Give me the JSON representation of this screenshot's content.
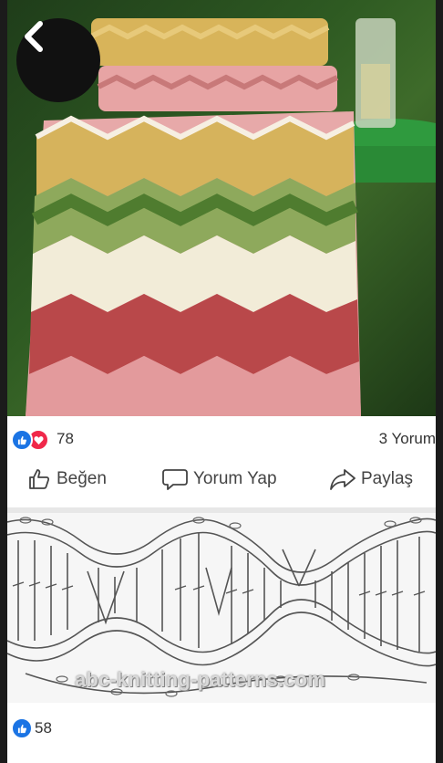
{
  "post": {
    "reaction_count": "78",
    "comments_label": "3 Yorum",
    "actions": {
      "like": "Beğen",
      "comment": "Yorum Yap",
      "share": "Paylaş"
    }
  },
  "pattern_image": {
    "watermark": "abc-knitting-patterns.com"
  },
  "next_post": {
    "reaction_count": "58"
  },
  "icons": {
    "back": "chevron-left-icon",
    "like": "thumbs-up-icon",
    "love": "heart-icon",
    "comment": "speech-bubble-icon",
    "share": "share-arrow-icon"
  },
  "colors": {
    "like_blue": "#1b74e4",
    "love_red": "#f0284a"
  }
}
